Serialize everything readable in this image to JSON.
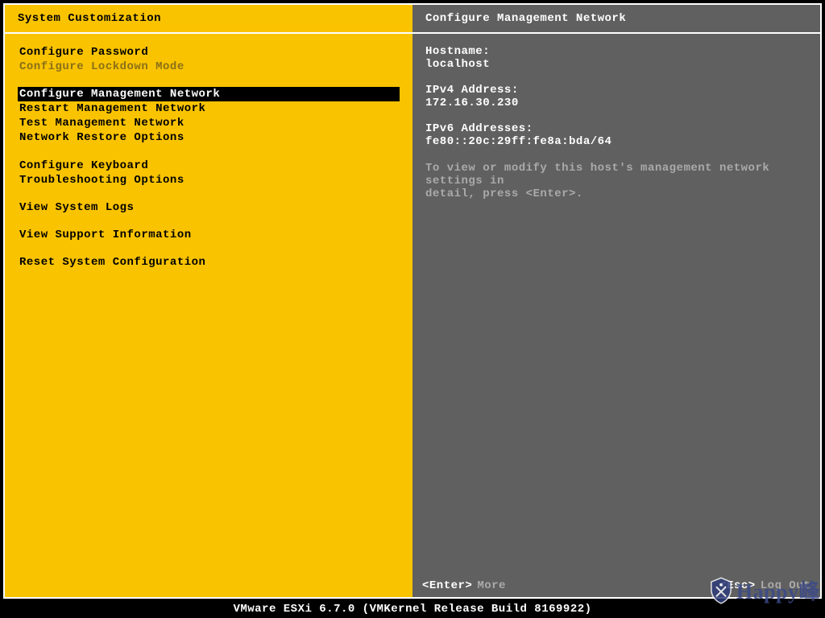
{
  "left": {
    "title": "System Customization",
    "groups": [
      [
        {
          "label": "Configure Password",
          "state": "normal"
        },
        {
          "label": "Configure Lockdown Mode",
          "state": "disabled"
        }
      ],
      [
        {
          "label": "Configure Management Network",
          "state": "selected"
        },
        {
          "label": "Restart Management Network",
          "state": "normal"
        },
        {
          "label": "Test Management Network",
          "state": "normal"
        },
        {
          "label": "Network Restore Options",
          "state": "normal"
        }
      ],
      [
        {
          "label": "Configure Keyboard",
          "state": "normal"
        },
        {
          "label": "Troubleshooting Options",
          "state": "normal"
        }
      ],
      [
        {
          "label": "View System Logs",
          "state": "normal"
        }
      ],
      [
        {
          "label": "View Support Information",
          "state": "normal"
        }
      ],
      [
        {
          "label": "Reset System Configuration",
          "state": "normal"
        }
      ]
    ]
  },
  "right": {
    "title": "Configure Management Network",
    "hostname_label": "Hostname:",
    "hostname_value": "localhost",
    "ipv4_label": "IPv4 Address:",
    "ipv4_value": "172.16.30.230",
    "ipv6_label": "IPv6 Addresses:",
    "ipv6_value": "fe80::20c:29ff:fe8a:bda/64",
    "help_line1": "To view or modify this host's management network settings in",
    "help_line2": "detail, press <Enter>.",
    "footer_enter_key": "<Enter>",
    "footer_enter_action": "More",
    "footer_esc_key": "<Esc>",
    "footer_esc_action": "Log Out"
  },
  "bottom_bar": "VMware ESXi 6.7.0 (VMKernel Release Build 8169922)",
  "watermark": "Happy峰"
}
